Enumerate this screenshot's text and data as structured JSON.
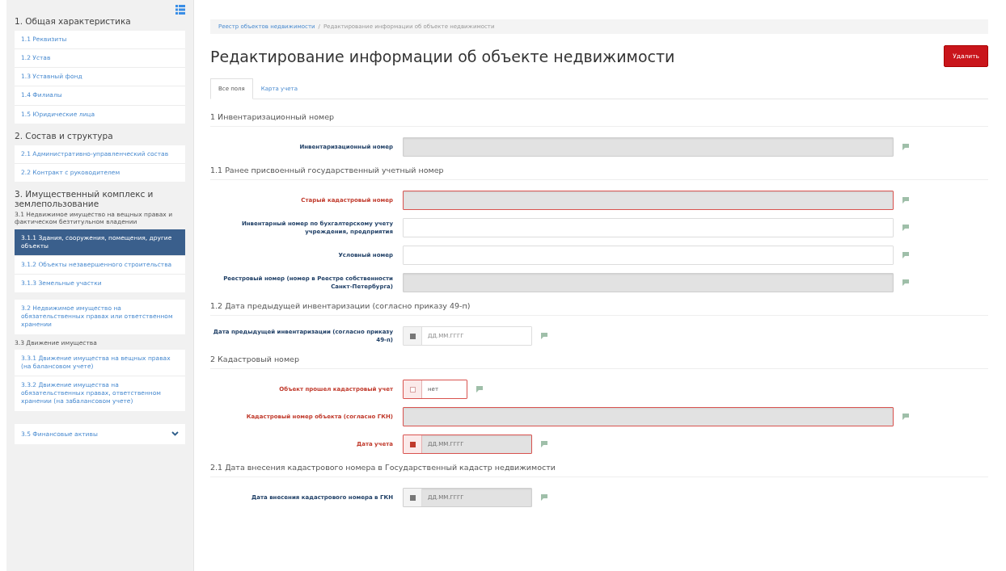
{
  "sidebar": {
    "blocks": [
      {
        "kind": "heading",
        "text": "1. Общая характеристика"
      },
      {
        "kind": "list",
        "items": [
          {
            "label": "1.1 Реквизиты",
            "selected": false
          },
          {
            "label": "1.2 Устав",
            "selected": false
          },
          {
            "label": "1.3 Уставный фонд",
            "selected": false
          },
          {
            "label": "1.4 Филиалы",
            "selected": false
          },
          {
            "label": "1.5 Юридические лица",
            "selected": false
          }
        ]
      },
      {
        "kind": "heading",
        "text": "2. Состав и структура"
      },
      {
        "kind": "list",
        "items": [
          {
            "label": "2.1 Административно-управленческий состав",
            "selected": false
          },
          {
            "label": "2.2 Контракт с руководителем",
            "selected": false
          }
        ]
      },
      {
        "kind": "heading",
        "text": "3. Имущественный комплекс и землепользование"
      },
      {
        "kind": "subheading",
        "text": "3.1 Недвижимое имущество на вещных правах и фактическом безтитульном владении"
      },
      {
        "kind": "list",
        "items": [
          {
            "label": "3.1.1 Здания, сооружения, помещения, другие объекты",
            "selected": true
          },
          {
            "label": "3.1.2 Объекты незавершенного строительства",
            "selected": false
          },
          {
            "label": "3.1.3 Земельные участки",
            "selected": false
          }
        ]
      },
      {
        "kind": "list",
        "items": [
          {
            "label": "3.2 Недвижимое имущество на обязательственных правах или ответственном хранении",
            "selected": false
          }
        ]
      },
      {
        "kind": "subheading",
        "text": "3.3 Движение имущества"
      },
      {
        "kind": "list",
        "items": [
          {
            "label": "3.3.1 Движение имущества на вещных правах (на балансовом учете)",
            "selected": false
          },
          {
            "label": "3.3.2 Движение имущества на обязательственных правах, ответственном хранении (на забалансовом учете)",
            "selected": false
          }
        ]
      },
      {
        "kind": "collapsible",
        "text": "3.5 Финансовые активы"
      }
    ]
  },
  "breadcrumb_separator": "/",
  "breadcrumb": [
    {
      "label": "Реестр объектов недвижимости",
      "kind": "link"
    },
    {
      "label": "Редактирование информации об объекте недвижимости",
      "kind": "current"
    }
  ],
  "page_title": "Редактирование информации об объекте недвижимости",
  "delete_button": "Удалить",
  "tabs": [
    {
      "label": "Все поля",
      "selected": true
    },
    {
      "label": "Карта учета",
      "selected": false
    }
  ],
  "sections": [
    {
      "title": "1 Инвентаризационный номер",
      "fields": [
        {
          "label": "Инвентаризационный номер",
          "kind": "text",
          "disabled": true,
          "error": false
        }
      ]
    },
    {
      "title": "1.1 Ранее присвоенный государственный учетный номер",
      "fields": [
        {
          "label": "Старый кадастровый номер",
          "kind": "text",
          "disabled": true,
          "error": true
        },
        {
          "label": "Инвентарный номер по бухгалтерскому учету учреждения, предприятия",
          "kind": "text",
          "disabled": false,
          "error": false
        },
        {
          "label": "Условный номер",
          "kind": "text",
          "disabled": false,
          "error": false
        },
        {
          "label": "Реестровый номер (номер в Реестре собственности Санкт-Петербурга)",
          "kind": "text",
          "disabled": true,
          "error": false
        }
      ]
    },
    {
      "title": "1.2 Дата предыдущей инвентаризации (согласно приказу 49-п)",
      "fields": [
        {
          "label": "Дата предыдущей инвентаризации (согласно приказу 49-п)",
          "kind": "date",
          "disabled": false,
          "error": false,
          "placeholder": "ДД.ММ.ГГГГ"
        }
      ]
    },
    {
      "title": "2 Кадастровый номер",
      "fields": [
        {
          "label": "Объект прошел кадастровый учет",
          "kind": "select",
          "disabled": false,
          "error": true,
          "value": "нет"
        },
        {
          "label": "Кадастровый номер объекта (согласно ГКН)",
          "kind": "text",
          "disabled": true,
          "error": true
        },
        {
          "label": "Дата учета",
          "kind": "date",
          "disabled": true,
          "error": true,
          "placeholder": "ДД.ММ.ГГГГ"
        }
      ]
    },
    {
      "title": "2.1 Дата внесения кадастрового номера в Государственный кадастр недвижимости",
      "fields": [
        {
          "label": "Дата внесения кадастрового номера в ГКН",
          "kind": "date",
          "disabled": true,
          "error": false,
          "placeholder": "ДД.ММ.ГГГГ"
        }
      ]
    }
  ]
}
